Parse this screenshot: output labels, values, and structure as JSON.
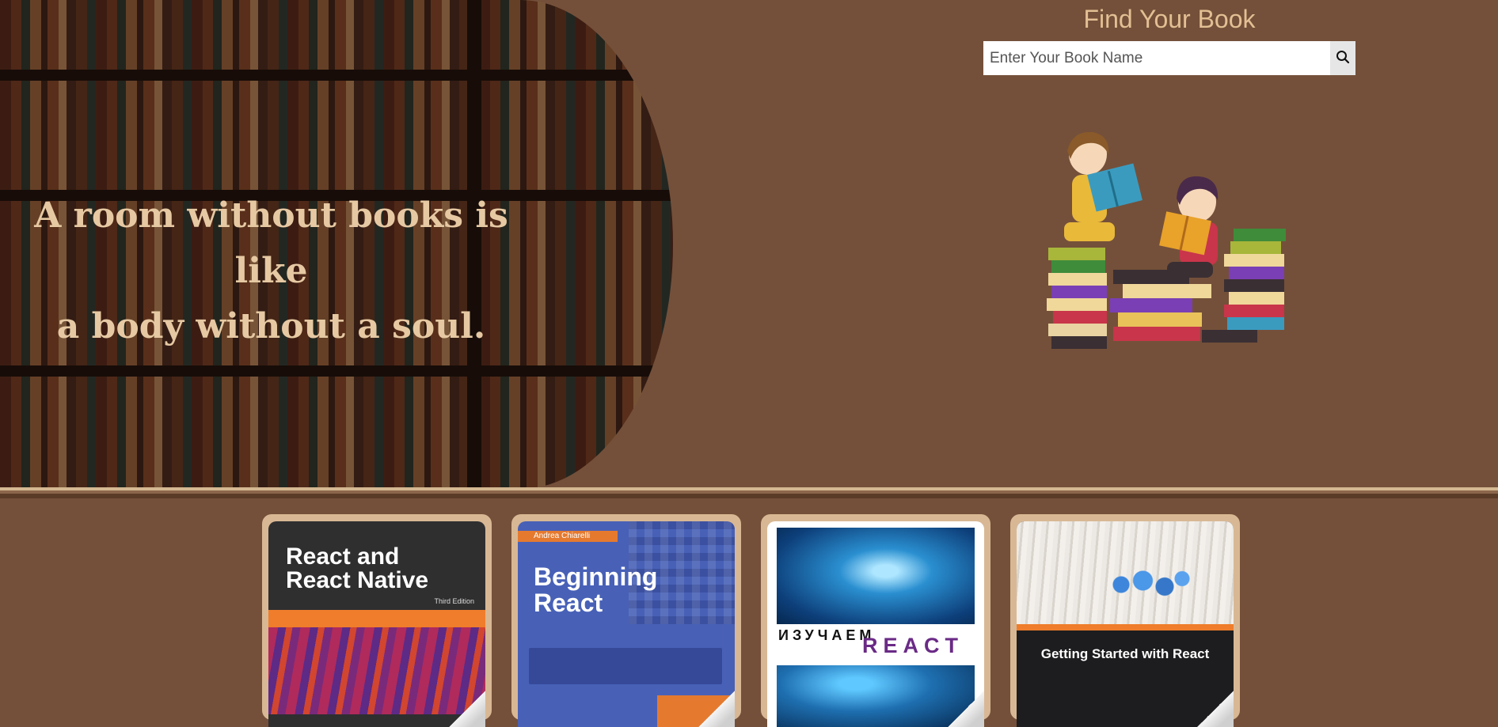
{
  "hero": {
    "quote_line1": "A room without books is like",
    "quote_line2": "a body without a soul.",
    "search_title": "Find Your Book",
    "search_placeholder": "Enter Your Book Name",
    "search_icon": "search-icon"
  },
  "books": [
    {
      "title_line1": "React and",
      "title_line2": "React Native",
      "edition": "Third Edition"
    },
    {
      "author": "Andrea Chiarelli",
      "title_line1": "Beginning",
      "title_line2": "React"
    },
    {
      "title_ru": "ИЗУЧАЕМ",
      "title_en": "REACT"
    },
    {
      "title": "Getting Started with React"
    }
  ],
  "colors": {
    "background": "#74503a",
    "accent_text": "#e3bf94",
    "card_frame": "#d8b894"
  }
}
